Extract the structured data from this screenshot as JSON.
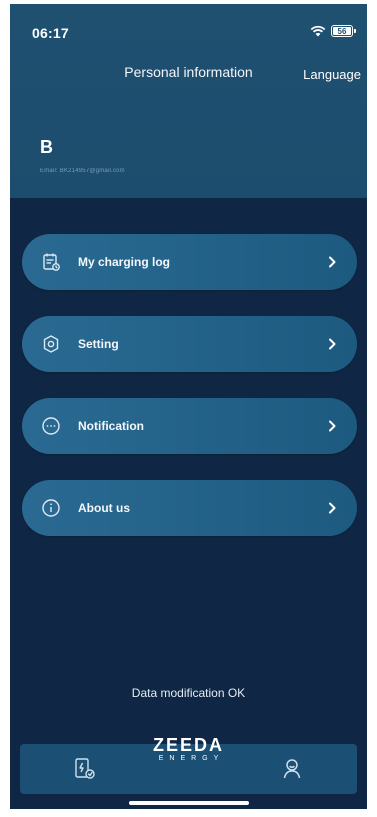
{
  "status": {
    "time": "06:17",
    "battery": "56"
  },
  "header": {
    "title": "Personal information",
    "language": "Language"
  },
  "profile": {
    "initial": "B",
    "email": "Email: BK214957@gmail.com"
  },
  "menu": [
    {
      "label": "My charging log",
      "icon": "calendar-log-icon"
    },
    {
      "label": "Setting",
      "icon": "gear-icon"
    },
    {
      "label": "Notification",
      "icon": "message-icon"
    },
    {
      "label": "About us",
      "icon": "info-icon"
    }
  ],
  "toast": "Data modification OK",
  "brand": {
    "name": "ZEEDA",
    "sub": "ENERGY"
  },
  "tabbar": [
    {
      "icon": "charging-station-icon"
    },
    {
      "icon": "profile-icon"
    }
  ],
  "colors": {
    "background": "#0f2744",
    "header": "#1f5070",
    "menu_item": "#2a6a92",
    "tabbar": "#1c4f74"
  }
}
